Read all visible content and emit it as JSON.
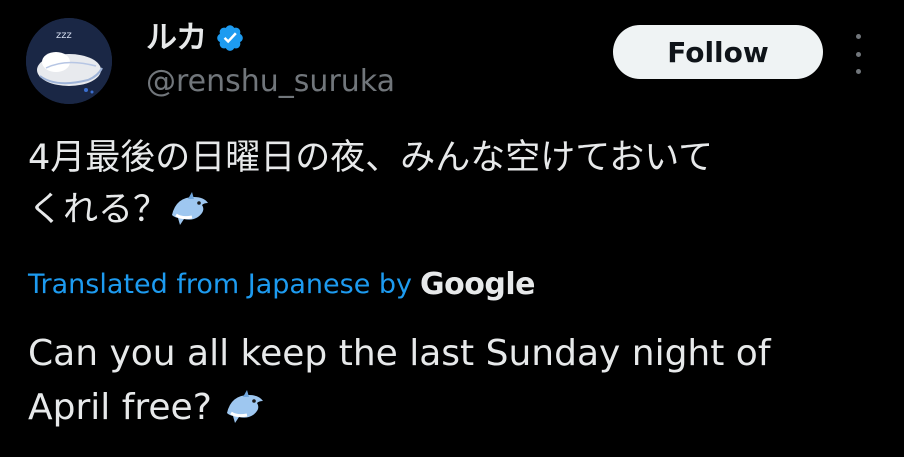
{
  "author": {
    "display_name": "ルカ",
    "handle": "@renshu_suruka",
    "verified": true,
    "avatar_doodle_text": "zzz"
  },
  "actions": {
    "follow_label": "Follow",
    "more_icon": "more-vertical-icon"
  },
  "tweet": {
    "text_line1": "4月最後の日曜日の夜、みんな空けておいて",
    "text_line2": "くれる？",
    "emoji": "dolphin-emoji"
  },
  "translation": {
    "link_text": "Translated from Japanese by",
    "provider": "Google",
    "text_line1": "Can you all keep the last Sunday night of",
    "text_line2": "April free?",
    "emoji": "dolphin-emoji"
  },
  "colors": {
    "background": "#000000",
    "text": "#e7e9ea",
    "muted": "#71767b",
    "accent": "#1d9bf0",
    "follow_bg": "#eff3f4",
    "follow_text": "#0f1419"
  }
}
